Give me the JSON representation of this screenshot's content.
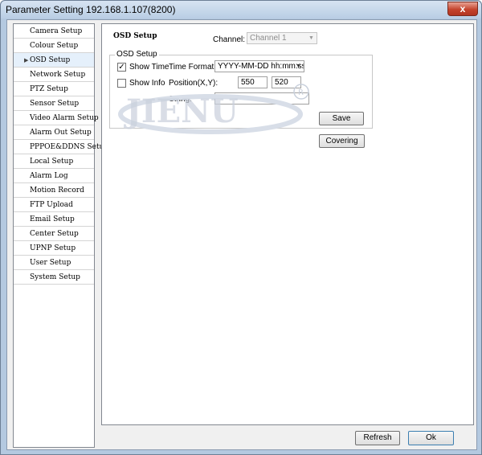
{
  "window": {
    "title": "Parameter Setting 192.168.1.107(8200)",
    "close_label": "x"
  },
  "sidebar": {
    "items": [
      {
        "label": "Camera Setup"
      },
      {
        "label": "Colour Setup"
      },
      {
        "label": "OSD Setup",
        "active": true
      },
      {
        "label": "Network Setup"
      },
      {
        "label": "PTZ Setup"
      },
      {
        "label": "Sensor Setup"
      },
      {
        "label": "Video Alarm Setup"
      },
      {
        "label": "Alarm Out Setup"
      },
      {
        "label": "PPPOE&DDNS Setup"
      },
      {
        "label": "Local Setup"
      },
      {
        "label": "Alarm Log"
      },
      {
        "label": "Motion Record"
      },
      {
        "label": "FTP Upload"
      },
      {
        "label": "Email Setup"
      },
      {
        "label": "Center Setup"
      },
      {
        "label": "UPNP Setup"
      },
      {
        "label": "User Setup"
      },
      {
        "label": "System Setup"
      }
    ]
  },
  "panel": {
    "title": "OSD Setup",
    "channel_label": "Channel:",
    "channel_value": "Channel 1",
    "group_title": "OSD Setup",
    "show_time_label": "Show Time",
    "show_time_checked": "✓",
    "show_info_label": "Show Info",
    "time_format_label": "Time Format:",
    "time_format_value": "YYYY-MM-DD hh:mm:ss",
    "position_label": "Position(X,Y):",
    "position_x": "550",
    "position_y": "520",
    "string_label": "String:",
    "string_value": "",
    "save_label": "Save",
    "covering_label": "Covering"
  },
  "footer": {
    "refresh_label": "Refresh",
    "ok_label": "Ok"
  },
  "watermark": {
    "text": "JIENU",
    "mark": "R"
  }
}
